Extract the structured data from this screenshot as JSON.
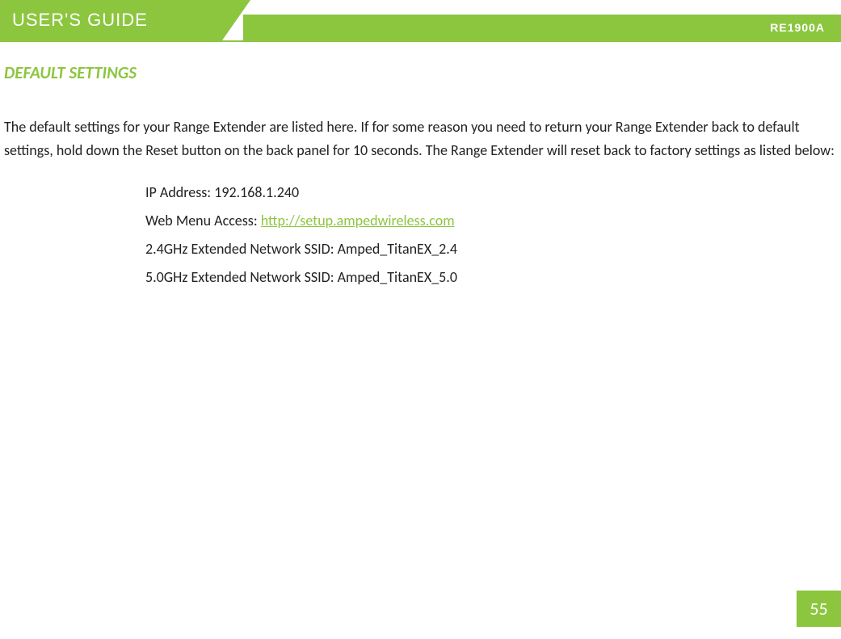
{
  "header": {
    "title": "USER'S GUIDE",
    "model": "RE1900A"
  },
  "section": {
    "title": "DEFAULT SETTINGS",
    "intro": "The default settings for your Range Extender are listed here. If for some reason you need to return your Range Extender back to default settings, hold down the Reset button on the back panel for 10 seconds. The Range Extender will reset back to factory settings as listed below:"
  },
  "settings": {
    "ip_label": "IP Address:  ",
    "ip_value": "192.168.1.240",
    "web_label": "Web Menu Access:  ",
    "web_url": "http://setup.ampedwireless.com",
    "ssid24_label": "2.4GHz Extended Network SSID:  ",
    "ssid24_value": "Amped_TitanEX_2.4",
    "ssid50_label": "5.0GHz Extended Network SSID:  ",
    "ssid50_value": "Amped_TitanEX_5.0"
  },
  "page_number": "55"
}
